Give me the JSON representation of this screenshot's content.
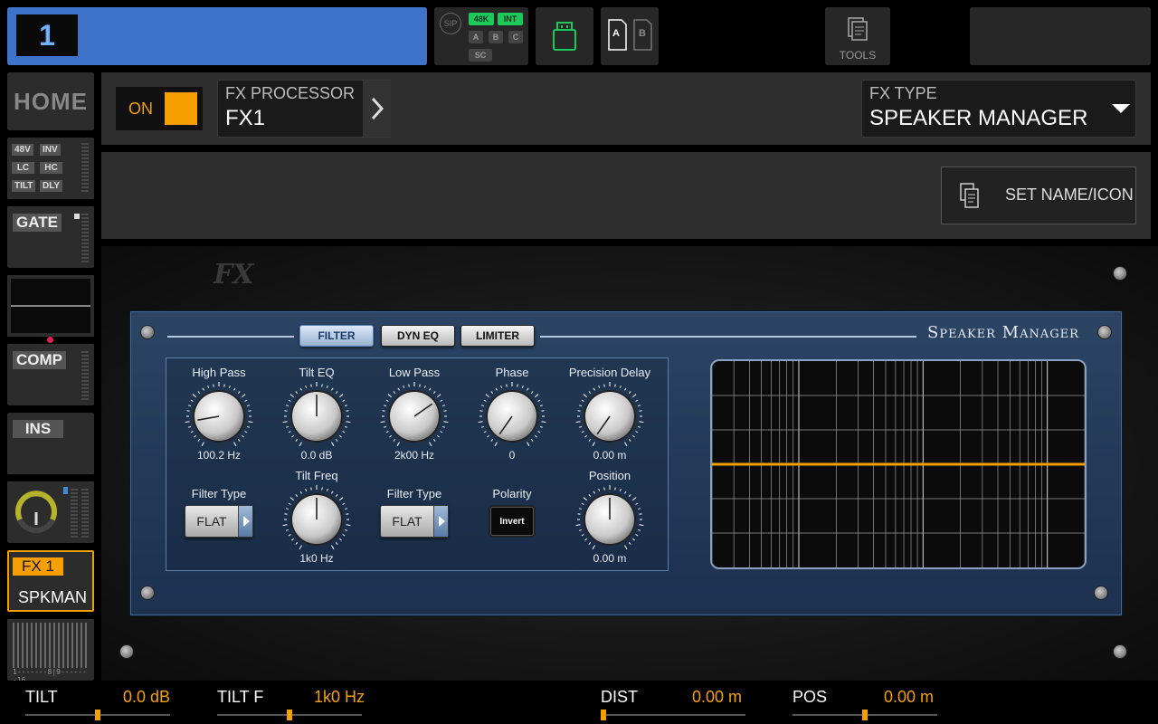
{
  "topbar": {
    "channel_number": "1",
    "status": {
      "sip": "SIP",
      "rate": "48K",
      "clock": "INT",
      "a": "A",
      "b": "B",
      "c": "C",
      "sc": "SC"
    },
    "card_a": "A",
    "card_b": "B",
    "tools_label": "TOOLS"
  },
  "sidebar": {
    "home": "HOME",
    "preamp": {
      "phantom": "48V",
      "invert": "INV",
      "lowcut": "LC",
      "highcut": "HC",
      "tilt": "TILT",
      "delay": "DLY"
    },
    "gate": "GATE",
    "comp": "COMP",
    "ins": "INS",
    "fx_tag": "FX 1",
    "fx_name": "SPKMAN",
    "bus_scale": "1-------8|9-------16"
  },
  "header": {
    "on_label": "ON",
    "processor_label": "FX PROCESSOR",
    "processor_value": "FX1",
    "fx_type_label": "FX TYPE",
    "fx_type_value": "SPEAKER MANAGER"
  },
  "namebar": {
    "set_name_label": "SET NAME/ICON"
  },
  "plugin": {
    "logo": "FX",
    "title": "Speaker Manager",
    "tabs": [
      "FILTER",
      "DYN EQ",
      "LIMITER"
    ],
    "active_tab": "FILTER",
    "controls": {
      "high_pass": {
        "label": "High Pass",
        "value": "100.2 Hz"
      },
      "tilt_eq": {
        "label": "Tilt EQ",
        "value": "0.0 dB"
      },
      "low_pass": {
        "label": "Low Pass",
        "value": "2k00 Hz"
      },
      "phase": {
        "label": "Phase",
        "value": "0"
      },
      "precision_delay": {
        "label": "Precision Delay",
        "value": "0.00 m"
      },
      "filter_type_1": {
        "label": "Filter Type",
        "value": "FLAT"
      },
      "tilt_freq": {
        "label": "Tilt Freq",
        "value": "1k0 Hz"
      },
      "filter_type_2": {
        "label": "Filter Type",
        "value": "FLAT"
      },
      "polarity": {
        "label": "Polarity",
        "button": "Invert"
      },
      "position": {
        "label": "Position",
        "value": "0.00 m"
      }
    }
  },
  "bottom": [
    {
      "name": "TILT",
      "value": "0.0 dB",
      "level": 0.5
    },
    {
      "name": "TILT F",
      "value": "1k0 Hz",
      "level": 0.5
    },
    {
      "name": "DIST",
      "value": "0.00 m",
      "level": 0.0
    },
    {
      "name": "POS",
      "value": "0.00 m",
      "level": 0.5
    }
  ],
  "colors": {
    "accent": "#f5a000",
    "channel": "#3f73c9",
    "green": "#1ec85a",
    "panel": "#2d2d2d"
  }
}
